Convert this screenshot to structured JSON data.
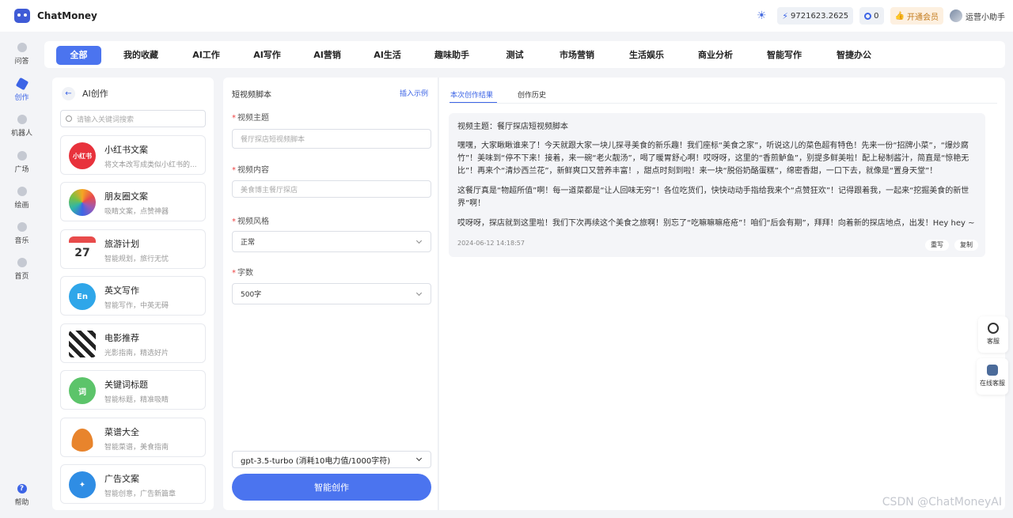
{
  "header": {
    "app_name": "ChatMoney",
    "balance": "9721623.2625",
    "count": "0",
    "vip_label": "开通会员",
    "user_name": "运营小助手"
  },
  "leftnav": {
    "items": [
      {
        "label": "问答",
        "icon": "chat-icon"
      },
      {
        "label": "创作",
        "icon": "pen-icon"
      },
      {
        "label": "机器人",
        "icon": "robot-icon"
      },
      {
        "label": "广场",
        "icon": "grid-icon"
      },
      {
        "label": "绘画",
        "icon": "palette-icon"
      },
      {
        "label": "音乐",
        "icon": "music-icon"
      },
      {
        "label": "首页",
        "icon": "home-icon"
      }
    ],
    "help_label": "帮助"
  },
  "tabs": [
    "全部",
    "我的收藏",
    "AI工作",
    "AI写作",
    "AI营销",
    "AI生活",
    "趣味助手",
    "测试",
    "市场营销",
    "生活娱乐",
    "商业分析",
    "智能写作",
    "智捷办公"
  ],
  "category_panel": {
    "title": "AI创作",
    "search_placeholder": "请输入关键词搜索",
    "cards": [
      {
        "title": "小红书文案",
        "desc": "将文本改写成类似小红书的...",
        "icon_text": "小红书",
        "color": "#e8323c"
      },
      {
        "title": "朋友圈文案",
        "desc": "吸睛文案，点赞神器",
        "icon_text": "",
        "color": "#f5a623"
      },
      {
        "title": "旅游计划",
        "desc": "智能规划，旅行无忧",
        "icon_text": "27",
        "color": "#e84b4b"
      },
      {
        "title": "英文写作",
        "desc": "智能写作，中英无碍",
        "icon_text": "En",
        "color": "#2fa6e9"
      },
      {
        "title": "电影推荐",
        "desc": "光影指南，精选好片",
        "icon_text": "",
        "color": "#333333"
      },
      {
        "title": "关键词标题",
        "desc": "智能标题，精准吸睛",
        "icon_text": "词",
        "color": "#5cc46a"
      },
      {
        "title": "菜谱大全",
        "desc": "智能菜谱，美食指南",
        "icon_text": "",
        "color": "#e8842c"
      },
      {
        "title": "广告文案",
        "desc": "智能创意，广告新篇章",
        "icon_text": "",
        "color": "#2f8de4"
      }
    ]
  },
  "form_panel": {
    "title": "短视频脚本",
    "insert_example": "插入示例",
    "fields": [
      {
        "label": "视频主题",
        "placeholder": "餐厅探店短视频脚本"
      },
      {
        "label": "视频内容",
        "placeholder": "美食博主餐厅探店"
      },
      {
        "label": "视频风格",
        "value": "正常"
      },
      {
        "label": "字数",
        "value": "500字"
      }
    ],
    "model": "gpt-3.5-turbo (消耗10电力值/1000字符)",
    "submit_label": "智能创作"
  },
  "result_panel": {
    "tab_current": "本次创作结果",
    "tab_history": "创作历史",
    "topic": "视频主题：餐厅探店短视频脚本",
    "paragraphs": [
      "嘿嘿，大家瞅瞅谁来了！今天就跟大家一块儿探寻美食的新乐趣！我们座标“美食之家”，听说这儿的菜色超有特色！先来一份“招牌小菜”，“爆炒腐竹”！美味到“停不下来！接着，来一碗“老火靓汤”，喝了暖胃舒心啊！哎呀呀，这里的“香煎鲈鱼”，别提多鲜美啦！配上秘制酱汁，简直是“惊艳无比”！再来个“清炒西兰花”，新鲜爽口又营养丰富！，甜点时刻到啦！来一块“脱俗奶酪蛋糕”，绵密香甜，一口下去，就像是“置身天堂”！",
      "这餐厅真是“物超所值”啊！每一道菜都是“让人回味无穷”！各位吃货们，快快动动手指给我来个“点赞狂欢”！记得跟着我，一起来“挖掘美食的新世界”啊！",
      "哎呀呀，探店就到这里啦！我们下次再续这个美食之旅啊！别忘了“吃嘛嘛嘛疮疮”！咱们“后会有期”，拜拜！向着新的探店地点，出发！Hey hey ~"
    ],
    "timestamp": "2024-06-12 14:18:57",
    "rewrite_label": "重写",
    "copy_label": "复制"
  },
  "floats": {
    "service_label": "客服",
    "online_service_label": "在线客服"
  },
  "watermark": "CSDN @ChatMoneyAI"
}
